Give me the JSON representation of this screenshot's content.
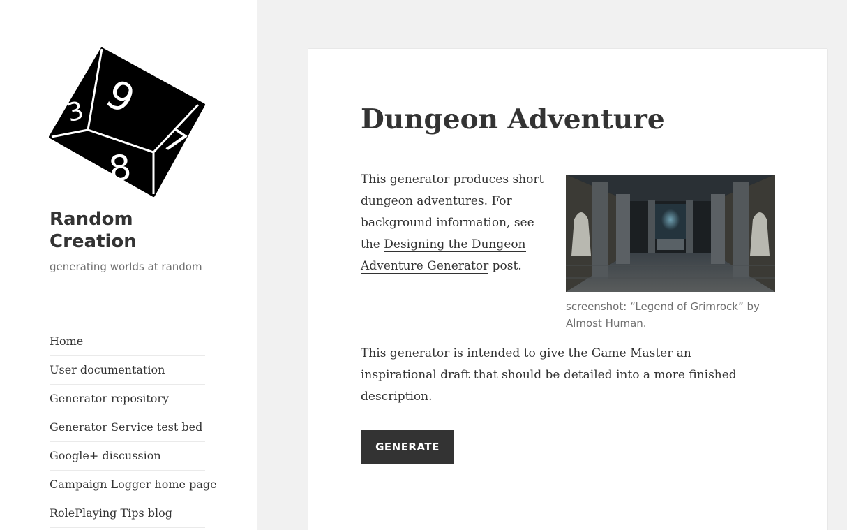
{
  "site": {
    "title": "Random Creation",
    "tagline": "generating worlds at random",
    "logo_icon": "d10-die-icon",
    "logo_numbers": [
      "9",
      "3",
      "7",
      "8"
    ]
  },
  "nav": {
    "items": [
      {
        "label": "Home"
      },
      {
        "label": "User documentation"
      },
      {
        "label": "Generator repository"
      },
      {
        "label": "Generator Service test bed"
      },
      {
        "label": "Google+ discussion"
      },
      {
        "label": "Campaign Logger home page"
      },
      {
        "label": "RolePlaying Tips blog"
      }
    ]
  },
  "article": {
    "title": "Dungeon Adventure",
    "intro_text": "This generator produces short dungeon adventures. For background information, see the",
    "intro_link": "Designing the Dungeon Adventure Generator",
    "intro_suffix": "post.",
    "figure_caption": "screenshot: “Legend of Grimrock” by Almost Human.",
    "purpose_text": "This generator is intended to give the Game Master an inspirational draft that should be detailed into a more finished description.",
    "generate_label": "GENERATE"
  },
  "colors": {
    "page_background": "#f1f1f1",
    "panel_background": "#ffffff",
    "text": "#333333",
    "muted_text": "#707070",
    "button_background": "#333333",
    "button_text": "#ffffff"
  }
}
